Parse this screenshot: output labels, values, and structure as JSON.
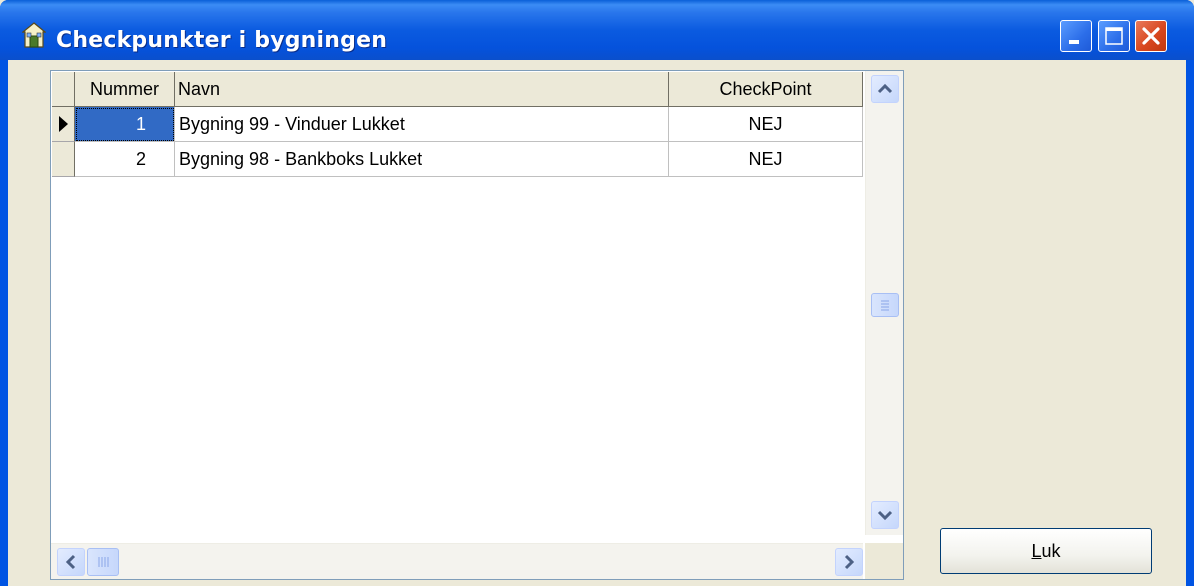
{
  "window": {
    "title": "Checkpunkter i bygningen",
    "icon": "building-app-icon"
  },
  "caption_buttons": [
    "minimize-icon",
    "maximize-icon",
    "close-icon"
  ],
  "grid": {
    "columns": [
      "Nummer",
      "Navn",
      "CheckPoint"
    ],
    "rows": [
      {
        "nummer": "1",
        "navn": "Bygning 99 - Vinduer Lukket",
        "checkpoint": "NEJ",
        "current": true
      },
      {
        "nummer": "2",
        "navn": "Bygning 98 - Bankboks Lukket",
        "checkpoint": "NEJ",
        "current": false
      }
    ]
  },
  "buttons": {
    "close_label_underlined": "L",
    "close_label_rest": "uk"
  },
  "colors": {
    "titlebar": "#0054e3",
    "selection": "#316ac5",
    "close_button": "#d9471f",
    "face": "#ece9d8"
  }
}
